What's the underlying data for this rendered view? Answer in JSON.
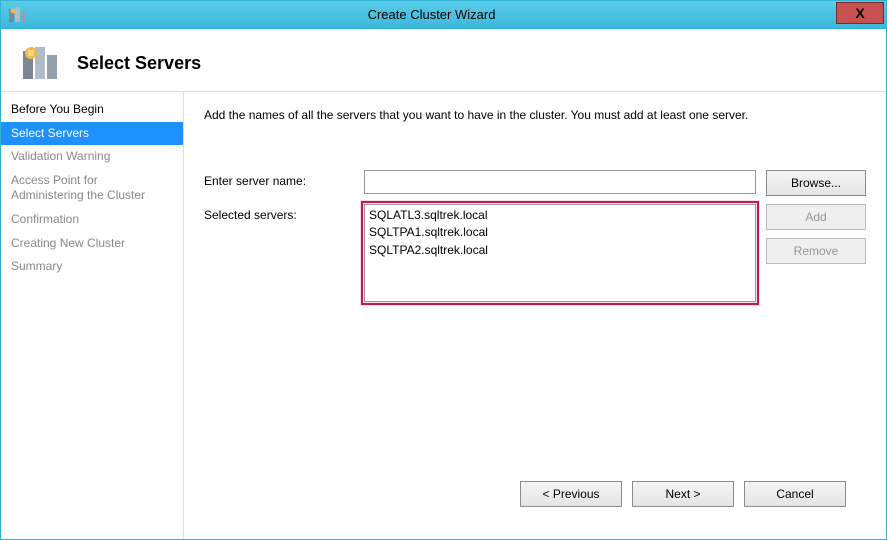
{
  "window": {
    "title": "Create Cluster Wizard",
    "close_glyph": "X"
  },
  "header": {
    "title": "Select Servers"
  },
  "sidebar": {
    "items": [
      {
        "label": "Before You Begin",
        "state": "past"
      },
      {
        "label": "Select Servers",
        "state": "active"
      },
      {
        "label": "Validation Warning",
        "state": "future"
      },
      {
        "label": "Access Point for Administering the Cluster",
        "state": "future"
      },
      {
        "label": "Confirmation",
        "state": "future"
      },
      {
        "label": "Creating New Cluster",
        "state": "future"
      },
      {
        "label": "Summary",
        "state": "future"
      }
    ]
  },
  "content": {
    "instruction": "Add the names of all the servers that you want to have in the cluster. You must add at least one server.",
    "enter_label": "Enter server name:",
    "enter_value": "",
    "selected_label": "Selected servers:",
    "selected_servers": [
      "SQLATL3.sqltrek.local",
      "SQLTPA1.sqltrek.local",
      "SQLTPA2.sqltrek.local"
    ],
    "buttons": {
      "browse": "Browse...",
      "add": "Add",
      "remove": "Remove"
    }
  },
  "footer": {
    "previous": "< Previous",
    "next": "Next >",
    "cancel": "Cancel"
  }
}
